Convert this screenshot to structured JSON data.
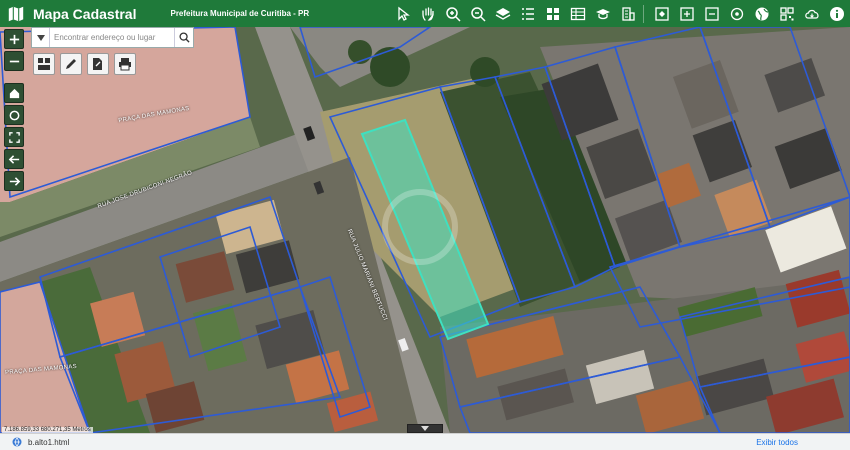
{
  "header": {
    "app_title": "Mapa Cadastral",
    "org_title": "Prefeitura Municipal de Curitiba - PR"
  },
  "toolbar": {
    "icons": [
      "pointer-icon",
      "pan-hand-icon",
      "zoom-in-icon",
      "zoom-out-icon",
      "layers-icon",
      "list-icon",
      "grid-icon",
      "table-icon",
      "education-icon",
      "building-icon",
      "map-window-icon",
      "add-window-icon",
      "remove-window-icon",
      "target-icon",
      "globe-icon",
      "qr-icon",
      "cloud-download-icon",
      "info-icon"
    ]
  },
  "search": {
    "placeholder": "Encontrar endereço ou lugar"
  },
  "map": {
    "street_labels": [
      "PRAÇA DAS MAMONAS",
      "RUA JOSE DRUBICONI NEGRÃO",
      "RUA JULIO MARIANI BERTUCCI",
      "PRAÇA DAS MAMONAS"
    ],
    "coordinates": "7.186.859,33 680.271,35 Metros",
    "highlight_color": "#3fe0c0",
    "parcel_line_color": "#2d5bd6"
  },
  "download": {
    "filename": "b.alto1.html",
    "show_all": "Exibir todos"
  }
}
